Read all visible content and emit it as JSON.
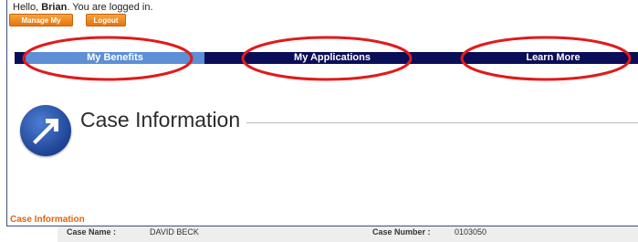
{
  "header": {
    "greeting_prefix": "Hello, ",
    "user_name": "Brian",
    "greeting_suffix": ". You are logged in.",
    "manage_account_label": "Manage My Account",
    "logout_label": "Logout"
  },
  "nav": {
    "tabs": [
      {
        "label": "My Benefits",
        "active": true
      },
      {
        "label": "My Applications",
        "active": false
      },
      {
        "label": "Learn More",
        "active": false
      }
    ]
  },
  "page": {
    "title": "Case Information",
    "icon": "arrow-icon"
  },
  "case_info": {
    "section_title": "Case Information",
    "case_name_label": "Case Name :",
    "case_name_value": "DAVID BECK",
    "case_number_label": "Case Number :",
    "case_number_value": "0103050"
  },
  "colors": {
    "nav_bar": "#0a0d57",
    "active_tab": "#5c8fd5",
    "orange_button": "#e6740e",
    "annotation_red": "#e01b1b",
    "section_title": "#e0650c"
  }
}
